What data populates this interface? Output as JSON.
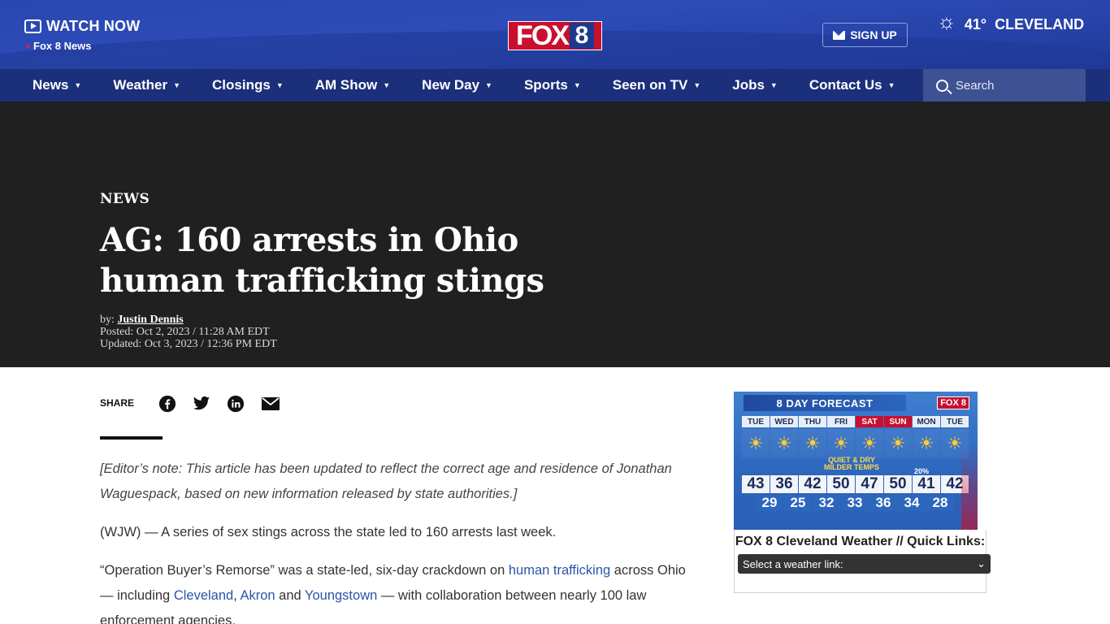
{
  "header": {
    "watch_label": "WATCH NOW",
    "live_label": "Fox 8 News",
    "logo_fox": "FOX",
    "logo_number": "8",
    "signup_label": "SIGN UP",
    "temperature": "41°",
    "city": "CLEVELAND"
  },
  "nav": {
    "items": [
      "News",
      "Weather",
      "Closings",
      "AM Show",
      "New Day",
      "Sports",
      "Seen on TV",
      "Jobs",
      "Contact Us"
    ],
    "search_placeholder": "Search"
  },
  "article": {
    "kicker": "NEWS",
    "headline": "AG: 160 arrests in Ohio human trafficking stings",
    "by_prefix": "by:",
    "author": "Justin Dennis",
    "posted": "Posted: Oct 2, 2023 / 11:28 AM EDT",
    "updated": "Updated: Oct 3, 2023 / 12:36 PM EDT",
    "share_label": "SHARE",
    "editor_note": "[Editor’s note: This article has been updated to reflect the correct age and residence of Jonathan Waguespack, based on new information released by state authorities.]",
    "p1": "(WJW) — A series of sex stings across the state led to 160 arrests last week.",
    "p2_a": "“Operation Buyer’s Remorse” was a state-led, six-day crackdown on ",
    "p2_link1": "human trafficking",
    "p2_b": " across Ohio — including ",
    "p2_link2": "Cleveland",
    "p2_c": ", ",
    "p2_link3": "Akron",
    "p2_d": " and ",
    "p2_link4": "Youngstown",
    "p2_e": " — with collaboration between nearly 100 law enforcement agencies."
  },
  "weather_widget": {
    "forecast_title": "8 DAY FORECAST",
    "forecast_logo": "FOX 8",
    "days": [
      "TUE",
      "WED",
      "THU",
      "FRI",
      "SAT",
      "SUN",
      "MON",
      "TUE"
    ],
    "weekend_days": [
      4,
      5
    ],
    "message_line1": "QUIET & DRY",
    "message_line2": "MILDER TEMPS",
    "precip": "20%",
    "highs": [
      "43",
      "36",
      "42",
      "50",
      "47",
      "50",
      "41",
      "42"
    ],
    "lows": [
      "29",
      "25",
      "32",
      "33",
      "36",
      "34",
      "28"
    ],
    "links_title": "FOX 8 Cleveland Weather // Quick Links:",
    "select_label": "Select a weather link:"
  },
  "colors": {
    "brand_blue": "#2a47b0",
    "nav_blue": "#1b2f7a",
    "fox_red": "#c8102e",
    "link_blue": "#2a55a8"
  }
}
